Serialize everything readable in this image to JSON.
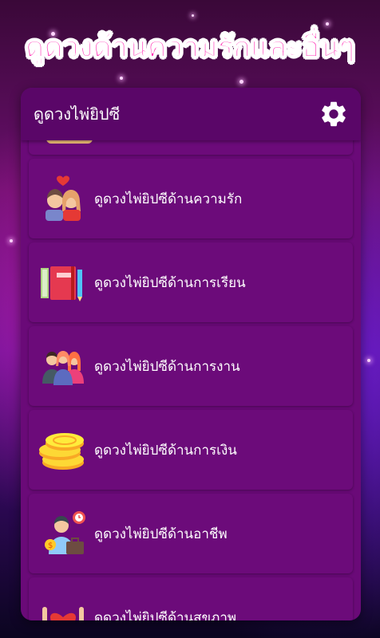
{
  "banner": {
    "title": "ดูดวงด้านความรักและอื่นๆ"
  },
  "appbar": {
    "title": "ดูดวงไพ่ยิปซี",
    "settings_icon": "gear-icon"
  },
  "list": {
    "items": [
      {
        "label": "ดูดวงไพ่ยิปซีด้านความรัก",
        "icon": "couple-heart-icon"
      },
      {
        "label": "ดูดวงไพ่ยิปซีด้านการเรียน",
        "icon": "notebook-pencil-icon"
      },
      {
        "label": "ดูดวงไพ่ยิปซีด้านการงาน",
        "icon": "team-people-icon"
      },
      {
        "label": "ดูดวงไพ่ยิปซีด้านการเงิน",
        "icon": "gold-coins-icon"
      },
      {
        "label": "ดูดวงไพ่ยิปซีด้านอาชีพ",
        "icon": "worker-briefcase-icon"
      },
      {
        "label": "ดูดวงไพ่ยิปซีด้านสุขภาพ",
        "icon": "hands-heart-icon"
      }
    ]
  },
  "colors": {
    "banner_text": "#ff2fb5",
    "panel": "#6a0a78",
    "appbar": "#5a0668",
    "item": "#6c0b7a"
  }
}
